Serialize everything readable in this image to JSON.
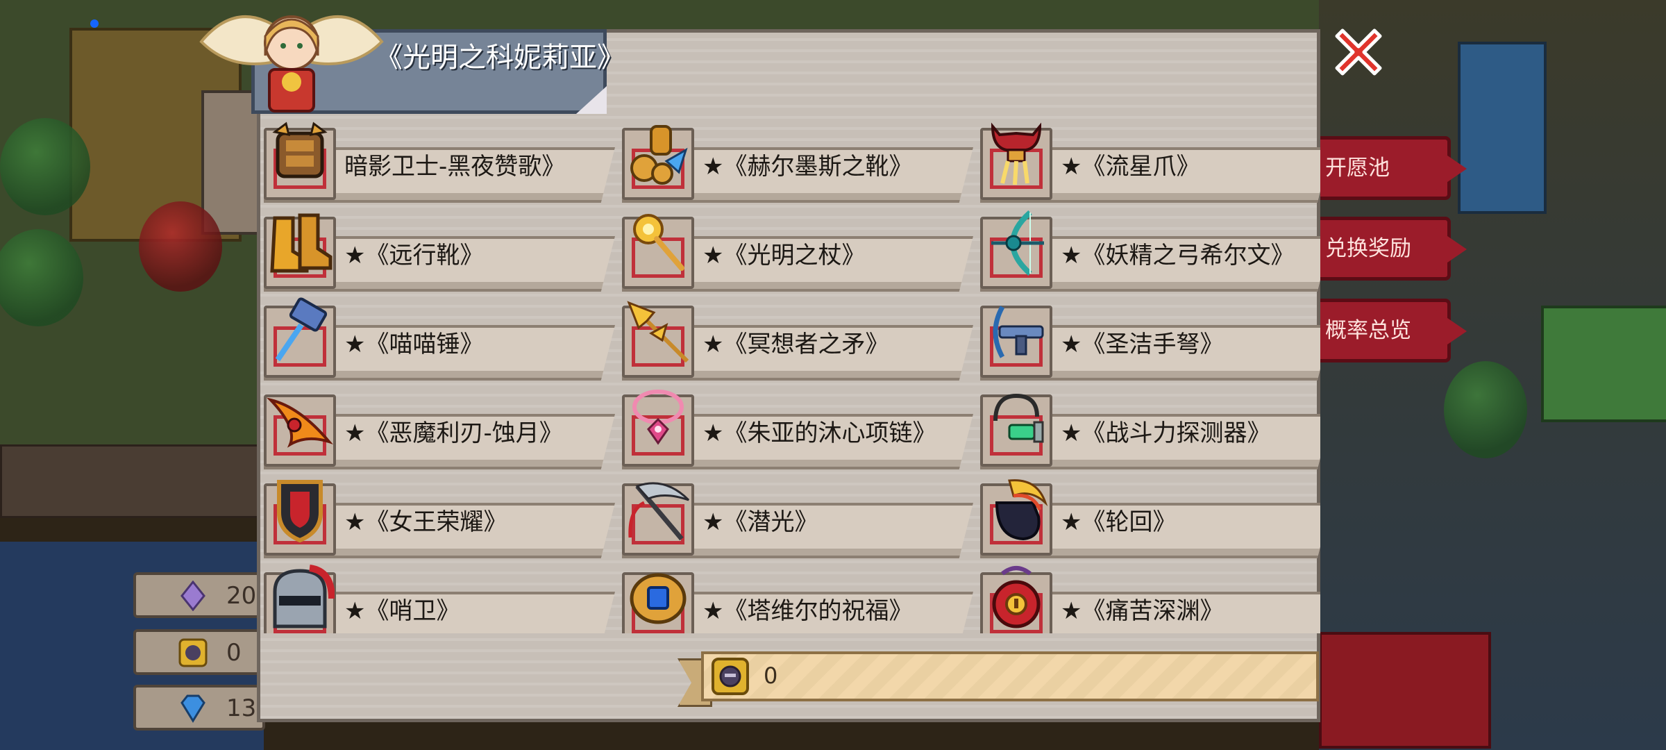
{
  "dialog": {
    "title": "《光明之科妮莉亚》",
    "close_label": "关闭"
  },
  "side_menu": [
    {
      "label": "开愿池"
    },
    {
      "label": "兑换奖励"
    },
    {
      "label": "概率总览"
    }
  ],
  "resources": [
    {
      "icon": "crystal-icon",
      "value": "20"
    },
    {
      "icon": "token-icon",
      "value": "0"
    },
    {
      "icon": "diamond-icon",
      "value": "13"
    }
  ],
  "items": [
    {
      "name": "暗影卫士-黑夜赞歌》",
      "icon": "armor-icon"
    },
    {
      "name": "★《赫尔墨斯之靴》",
      "icon": "boots-gold-icon"
    },
    {
      "name": "★《流星爪》",
      "icon": "claw-icon"
    },
    {
      "name": "★《远行靴》",
      "icon": "boots-icon"
    },
    {
      "name": "★《光明之杖》",
      "icon": "staff-icon"
    },
    {
      "name": "★《妖精之弓希尔文》",
      "icon": "bow-icon"
    },
    {
      "name": "★《喵喵锤》",
      "icon": "hammer-icon"
    },
    {
      "name": "★《冥想者之矛》",
      "icon": "spear-icon"
    },
    {
      "name": "★《圣洁手弩》",
      "icon": "crossbow-icon"
    },
    {
      "name": "★《恶魔利刃-蚀月》",
      "icon": "blade-icon"
    },
    {
      "name": "★《朱亚的沐心项链》",
      "icon": "necklace-icon"
    },
    {
      "name": "★《战斗力探测器》",
      "icon": "scouter-icon"
    },
    {
      "name": "★《女王荣耀》",
      "icon": "shield-icon"
    },
    {
      "name": "★《潜光》",
      "icon": "scythe-icon"
    },
    {
      "name": "★《轮回》",
      "icon": "gauntlet-icon"
    },
    {
      "name": "★《哨卫》",
      "icon": "helmet-icon"
    },
    {
      "name": "★《塔维尔的祝福》",
      "icon": "ring-icon"
    },
    {
      "name": "★《痛苦深渊》",
      "icon": "amulet-icon"
    }
  ],
  "currency": {
    "icon": "token-icon",
    "value": "0"
  }
}
